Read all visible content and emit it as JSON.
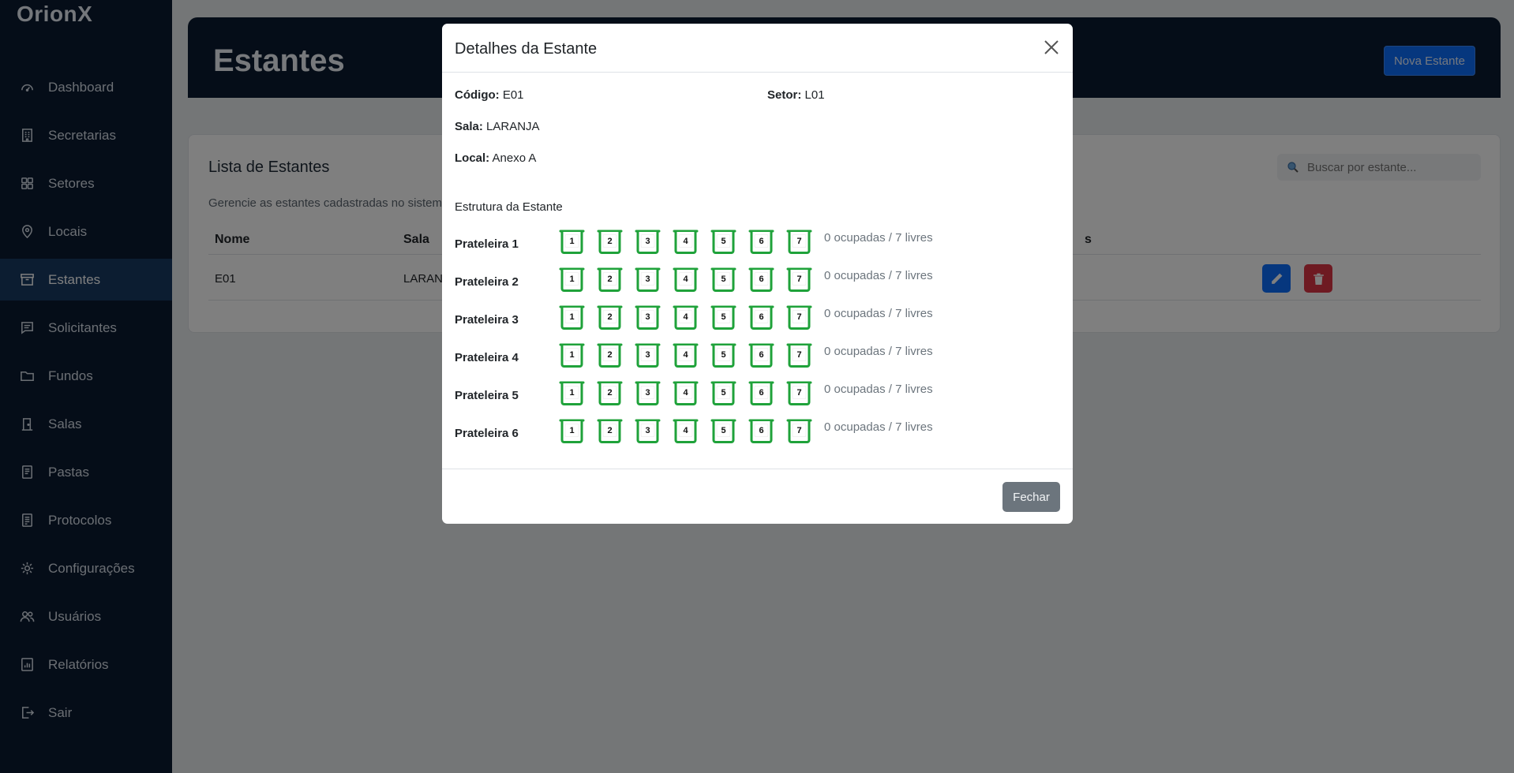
{
  "app": {
    "brand": "OrionX"
  },
  "sidebar": {
    "items": [
      {
        "label": "Dashboard",
        "icon": "dashboard-icon"
      },
      {
        "label": "Secretarias",
        "icon": "building-icon"
      },
      {
        "label": "Setores",
        "icon": "grid-icon"
      },
      {
        "label": "Locais",
        "icon": "map-pin-icon"
      },
      {
        "label": "Estantes",
        "icon": "archive-icon",
        "active": true
      },
      {
        "label": "Solicitantes",
        "icon": "message-icon"
      },
      {
        "label": "Fundos",
        "icon": "folder-icon"
      },
      {
        "label": "Salas",
        "icon": "door-icon"
      },
      {
        "label": "Pastas",
        "icon": "document-icon"
      },
      {
        "label": "Protocolos",
        "icon": "file-text-icon"
      },
      {
        "label": "Configurações",
        "icon": "gear-icon"
      },
      {
        "label": "Usuários",
        "icon": "users-icon"
      },
      {
        "label": "Relatórios",
        "icon": "report-icon"
      },
      {
        "label": "Sair",
        "icon": "logout-icon"
      }
    ]
  },
  "header": {
    "title": "Estantes",
    "new_button": "Nova Estante"
  },
  "list": {
    "title": "Lista de Estantes",
    "subtitle": "Gerencie as estantes cadastradas no sistem",
    "search_placeholder": "Buscar por estante...",
    "columns": [
      "Nome",
      "Sala",
      "s"
    ],
    "rows": [
      {
        "nome": "E01",
        "sala": "LARAN"
      }
    ]
  },
  "modal": {
    "title": "Detalhes da Estante",
    "codigo_label": "Código:",
    "codigo_value": "E01",
    "setor_label": "Setor:",
    "setor_value": "L01",
    "sala_label": "Sala:",
    "sala_value": "LARANJA",
    "local_label": "Local:",
    "local_value": "Anexo A",
    "structure_title": "Estrutura da Estante",
    "shelves": [
      {
        "label": "Prateleira 1",
        "slots": [
          "1",
          "2",
          "3",
          "4",
          "5",
          "6",
          "7"
        ],
        "stats": "0 ocupadas / 7 livres"
      },
      {
        "label": "Prateleira 2",
        "slots": [
          "1",
          "2",
          "3",
          "4",
          "5",
          "6",
          "7"
        ],
        "stats": "0 ocupadas / 7 livres"
      },
      {
        "label": "Prateleira 3",
        "slots": [
          "1",
          "2",
          "3",
          "4",
          "5",
          "6",
          "7"
        ],
        "stats": "0 ocupadas / 7 livres"
      },
      {
        "label": "Prateleira 4",
        "slots": [
          "1",
          "2",
          "3",
          "4",
          "5",
          "6",
          "7"
        ],
        "stats": "0 ocupadas / 7 livres"
      },
      {
        "label": "Prateleira 5",
        "slots": [
          "1",
          "2",
          "3",
          "4",
          "5",
          "6",
          "7"
        ],
        "stats": "0 ocupadas / 7 livres"
      },
      {
        "label": "Prateleira 6",
        "slots": [
          "1",
          "2",
          "3",
          "4",
          "5",
          "6",
          "7"
        ],
        "stats": "0 ocupadas / 7 livres"
      }
    ],
    "close_button": "Fechar"
  },
  "colors": {
    "sidebar_bg": "#0b1a30",
    "active_item_bg": "#183a63",
    "slot_free": "#1fa23a",
    "primary": "#0d6efd",
    "danger": "#dc3545",
    "secondary": "#6c757d"
  }
}
